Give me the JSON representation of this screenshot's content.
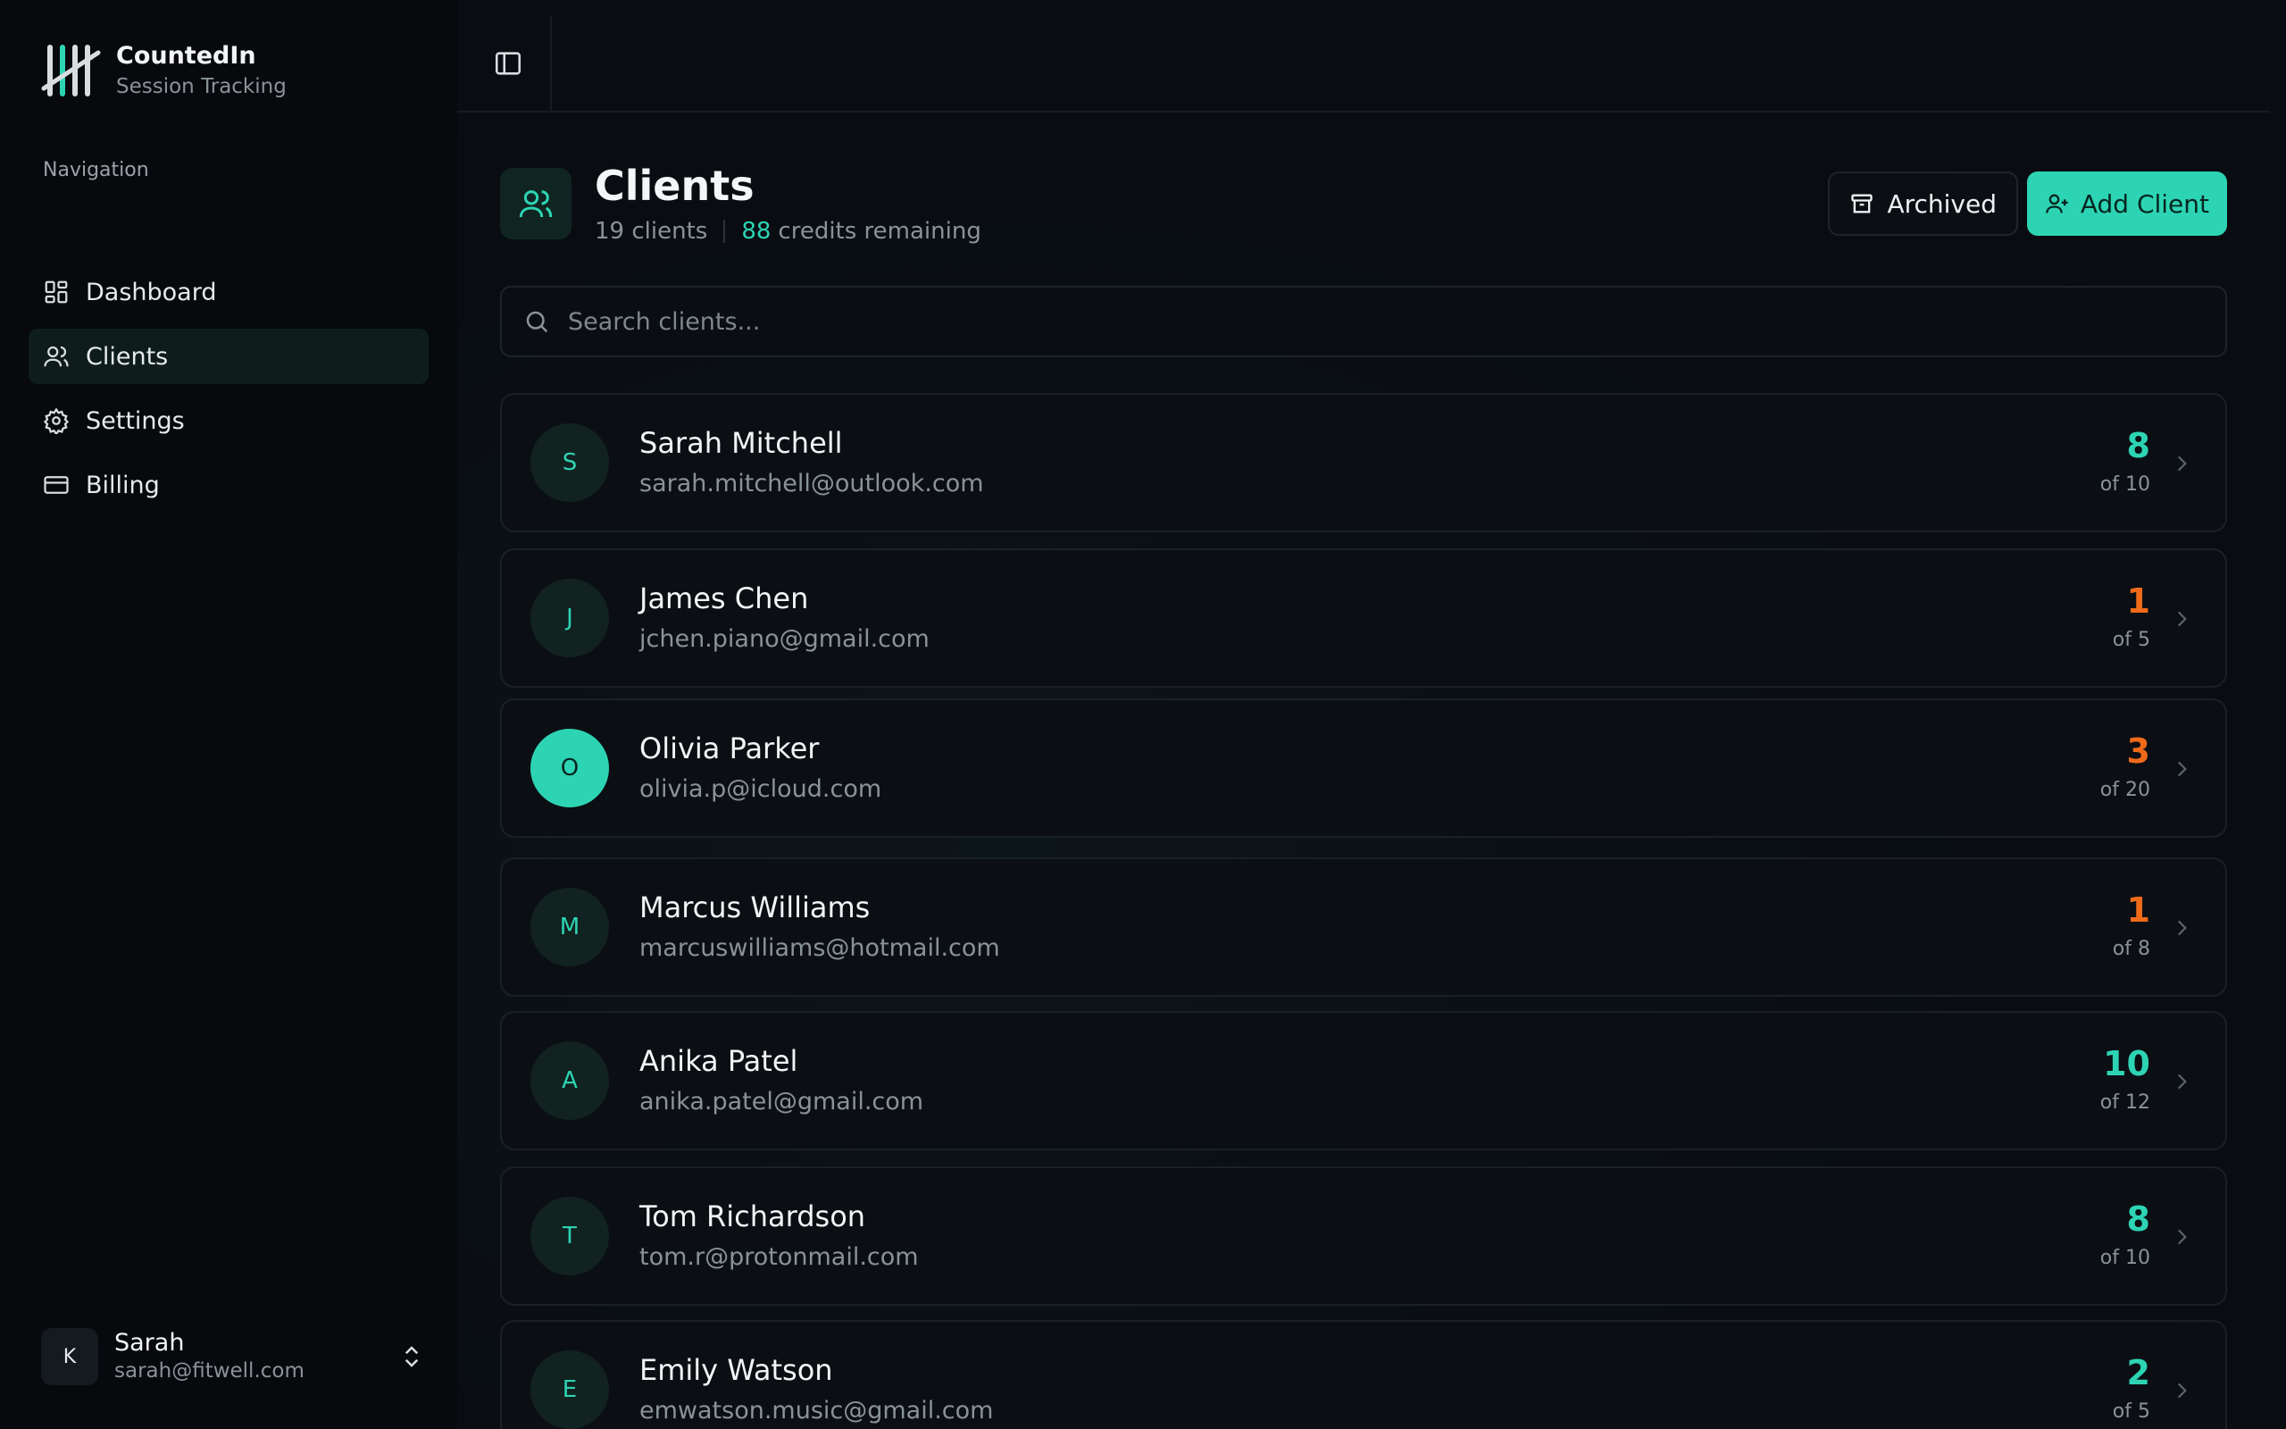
{
  "brand": {
    "title": "CountedIn",
    "subtitle": "Session Tracking"
  },
  "nav": {
    "heading": "Navigation",
    "items": [
      {
        "label": "Dashboard",
        "icon": "dashboard-icon",
        "active": false
      },
      {
        "label": "Clients",
        "icon": "users-icon",
        "active": true
      },
      {
        "label": "Settings",
        "icon": "gear-icon",
        "active": false
      },
      {
        "label": "Billing",
        "icon": "credit-card-icon",
        "active": false
      }
    ]
  },
  "user": {
    "initial": "K",
    "name": "Sarah",
    "email": "sarah@fitwell.com"
  },
  "page": {
    "title": "Clients",
    "client_count": "19 clients",
    "credits_value": "88",
    "credits_label": "credits remaining",
    "archived_label": "Archived",
    "add_label": "Add Client"
  },
  "search": {
    "placeholder": "Search clients...",
    "value": ""
  },
  "colors": {
    "accent": "#2dd4b4",
    "warning": "#f06a1a",
    "background": "#090c10"
  },
  "clients": [
    {
      "initial": "S",
      "name": "Sarah Mitchell",
      "email": "sarah.mitchell@outlook.com",
      "credits": "8",
      "of": "of 10",
      "status": "good",
      "avatar_filled": false
    },
    {
      "initial": "J",
      "name": "James Chen",
      "email": "jchen.piano@gmail.com",
      "credits": "1",
      "of": "of 5",
      "status": "low",
      "avatar_filled": false
    },
    {
      "initial": "O",
      "name": "Olivia Parker",
      "email": "olivia.p@icloud.com",
      "credits": "3",
      "of": "of 20",
      "status": "low",
      "avatar_filled": true
    },
    {
      "initial": "M",
      "name": "Marcus Williams",
      "email": "marcuswilliams@hotmail.com",
      "credits": "1",
      "of": "of 8",
      "status": "low",
      "avatar_filled": false
    },
    {
      "initial": "A",
      "name": "Anika Patel",
      "email": "anika.patel@gmail.com",
      "credits": "10",
      "of": "of 12",
      "status": "good",
      "avatar_filled": false
    },
    {
      "initial": "T",
      "name": "Tom Richardson",
      "email": "tom.r@protonmail.com",
      "credits": "8",
      "of": "of 10",
      "status": "good",
      "avatar_filled": false
    },
    {
      "initial": "E",
      "name": "Emily Watson",
      "email": "emwatson.music@gmail.com",
      "credits": "2",
      "of": "of 5",
      "status": "good",
      "avatar_filled": false
    }
  ]
}
